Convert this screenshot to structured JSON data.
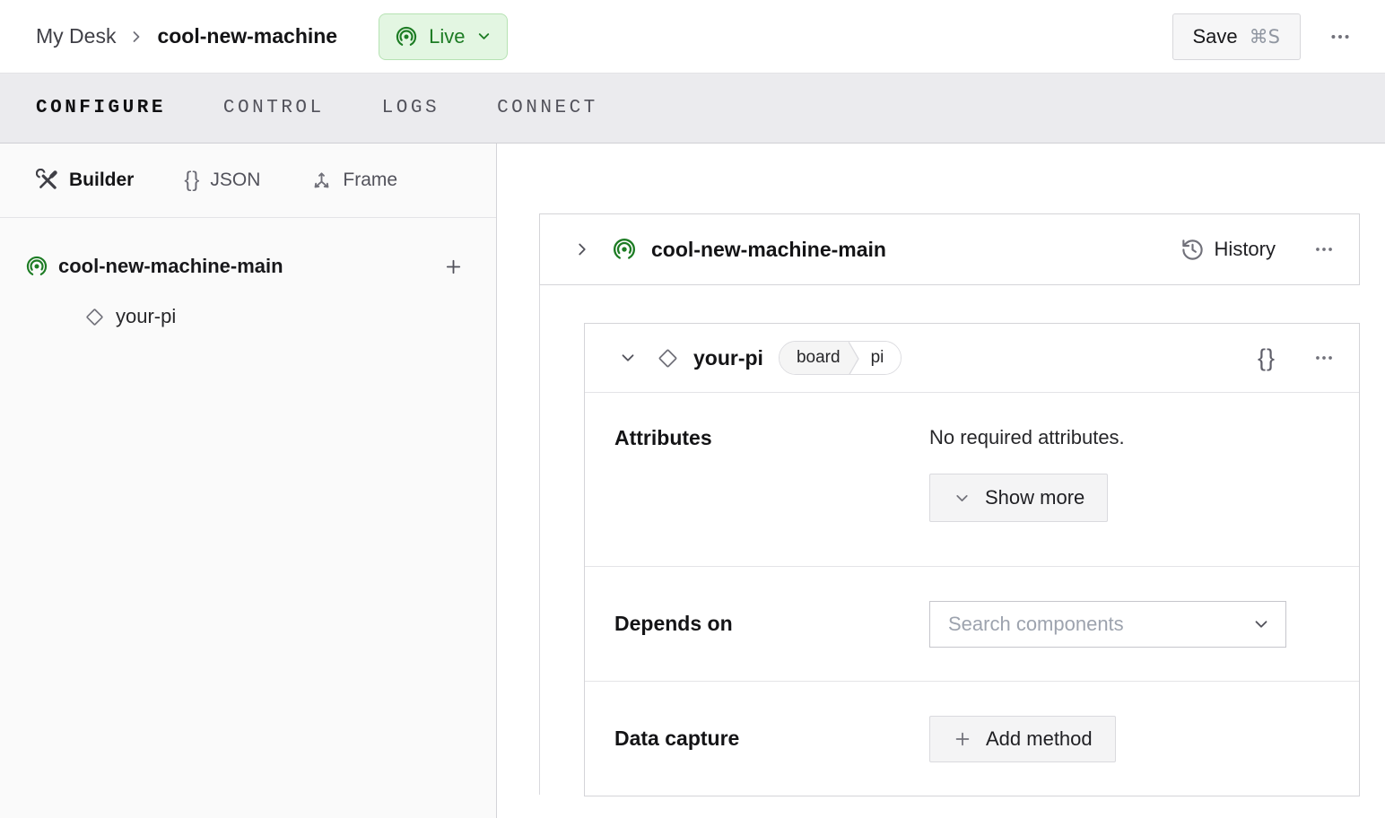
{
  "header": {
    "breadcrumb": {
      "parent": "My Desk",
      "current": "cool-new-machine"
    },
    "live": {
      "label": "Live"
    },
    "save": {
      "label": "Save",
      "shortcut": "⌘S"
    }
  },
  "tabs": {
    "configure": "CONFIGURE",
    "control": "CONTROL",
    "logs": "LOGS",
    "connect": "CONNECT"
  },
  "sidebar": {
    "modes": {
      "builder": "Builder",
      "json": "JSON",
      "frame": "Frame"
    },
    "tree": {
      "machine": "cool-new-machine-main",
      "component": "your-pi"
    }
  },
  "main": {
    "machine_card": {
      "title": "cool-new-machine-main",
      "history": "History"
    },
    "component_card": {
      "title": "your-pi",
      "badge": {
        "type": "board",
        "model": "pi"
      },
      "attributes": {
        "label": "Attributes",
        "empty": "No required attributes.",
        "show_more": "Show more"
      },
      "depends_on": {
        "label": "Depends on",
        "placeholder": "Search components"
      },
      "data_capture": {
        "label": "Data capture",
        "add_method": "Add method"
      }
    }
  },
  "icons": {
    "braces": "{}"
  },
  "colors": {
    "accent_green": "#1d7c24",
    "live_badge_bg": "#e3f6e2",
    "live_badge_border": "#b6e2b3",
    "tabbar_bg": "#ebebee",
    "card_border": "#d4d4d8"
  }
}
